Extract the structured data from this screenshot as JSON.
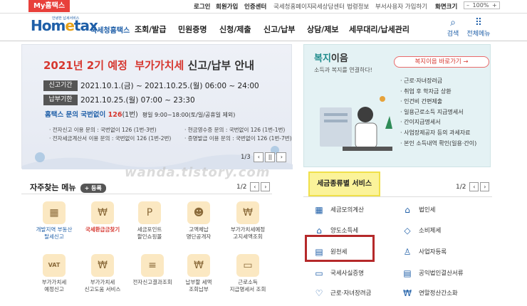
{
  "top": {
    "my_tab": "My홈택스",
    "links": [
      "로그인",
      "회원가입",
      "인증센터",
      "국세청홈페이지",
      "국세상담센터",
      "법령정보",
      "부서사용자 가입하기",
      "화면크기"
    ],
    "zoom": "100%",
    "zoom_minus": "–",
    "zoom_plus": "+"
  },
  "header": {
    "logo_tiny": "안녕한 납세서비스",
    "logo_home": "Hom",
    "logo_e": "e",
    "logo_tax": "tax",
    "logo_kr": "국세청홈택스",
    "menu": [
      "조회/발급",
      "민원증명",
      "신청/제출",
      "신고/납부",
      "상담/제보",
      "세무대리/납세관리"
    ],
    "search_label": "검색",
    "all_menu_label": "전체메뉴"
  },
  "banner": {
    "title_red": "2021년 2기 예정",
    "title_red2": "부가가치세",
    "title_rest": " 신고/납부 안내",
    "period_label": "신고기간",
    "period_value": "2021.10.1.(금) ~ 2021.10.25.(월) 06:00 ~ 24:00",
    "deadline_label": "납부기한",
    "deadline_value": "2021.10.25.(월) 07:00 ~ 23:30",
    "inquiry_brand": "홈택스",
    "inquiry_text": " 문의 국번없이 ",
    "inquiry_number": "126",
    "inquiry_suffix": "(1번)",
    "inquiry_hours": "평일 9:00~18:00(토/일/공휴일 제외)",
    "info_rows": [
      [
        "· 전자신고 이용 문의 : 국번없이 126 (1번-3번)",
        "· 현금영수증 문의 : 국번없이 126 (1번-1번)"
      ],
      [
        "· 전자세금계산서 이용 문의 : 국번없이 126 (1번-2번)",
        "· 증명발급 이용 문의 : 국번없이 126 (1번-7번)"
      ]
    ],
    "pager": "1/3",
    "pager_prev": "‹",
    "pager_pause": "||",
    "pager_next": "›"
  },
  "welfare": {
    "title_a": "복지",
    "title_b": "이음",
    "subtitle": "소득과 복지를 연결하다!",
    "button": "복지이음 바로가기",
    "items": [
      "· 근로·자녀장려금",
      "· 취업 후 학자금 상환",
      "· 인건비 간편제출",
      "· 일용근로소득 지급명세서",
      "· 간이지급명세서",
      "· 사업장제공자 등의 과세자료",
      "· 본인 소득내역 확인(일용·간이)"
    ]
  },
  "quick": {
    "title": "자주찾는 메뉴",
    "register": "+ 등록",
    "pager": "1/2",
    "prev": "‹",
    "next": "›",
    "items": [
      {
        "label": "개발지역 부동산\n탈세신고",
        "glyph": "▦",
        "style": "blue"
      },
      {
        "label": "국세환급금찾기",
        "glyph": "₩",
        "style": "red"
      },
      {
        "label": "세금포인트\n할인쇼핑몰",
        "glyph": "P",
        "style": ""
      },
      {
        "label": "고액체납\n명단공개자",
        "glyph": "☻",
        "style": ""
      },
      {
        "label": "부가가치세예정\n고지세액조회",
        "glyph": "₩",
        "style": ""
      },
      {
        "label": "부가가치세\n예정신고",
        "glyph": "VAT",
        "style": ""
      },
      {
        "label": "부가가치세\n신고도움 서비스",
        "glyph": "₩",
        "style": ""
      },
      {
        "label": "전자신고결과조회",
        "glyph": "≡",
        "style": ""
      },
      {
        "label": "납부할 세액\n조회납부",
        "glyph": "₩",
        "style": ""
      },
      {
        "label": "근로소득\n지급명세서 조회",
        "glyph": "▭",
        "style": ""
      }
    ]
  },
  "services": {
    "title": "세금종류별 서비스",
    "pager": "1/2",
    "prev": "‹",
    "next": "›",
    "items": [
      {
        "label": "세금모의계산",
        "icon": "▦"
      },
      {
        "label": "법인세",
        "icon": "⌂"
      },
      {
        "label": "양도소득세",
        "icon": "⌂"
      },
      {
        "label": "소비제세",
        "icon": "◇"
      },
      {
        "label": "원천세",
        "icon": "▤"
      },
      {
        "label": "사업자등록",
        "icon": "♙"
      },
      {
        "label": "국세사실증명",
        "icon": "▭"
      },
      {
        "label": "공익법인결산서류",
        "icon": "▤"
      },
      {
        "label": "근로·자녀장려금",
        "icon": "♡"
      },
      {
        "label": "연말정산간소화",
        "icon": "₩"
      }
    ]
  },
  "watermark": "wanda.tistory.com",
  "colors": {
    "brand": "#1f5fa8",
    "accent_red": "#d6372f",
    "highlight": "#fbf39a",
    "welfare_bg": "#e4f2f4"
  }
}
